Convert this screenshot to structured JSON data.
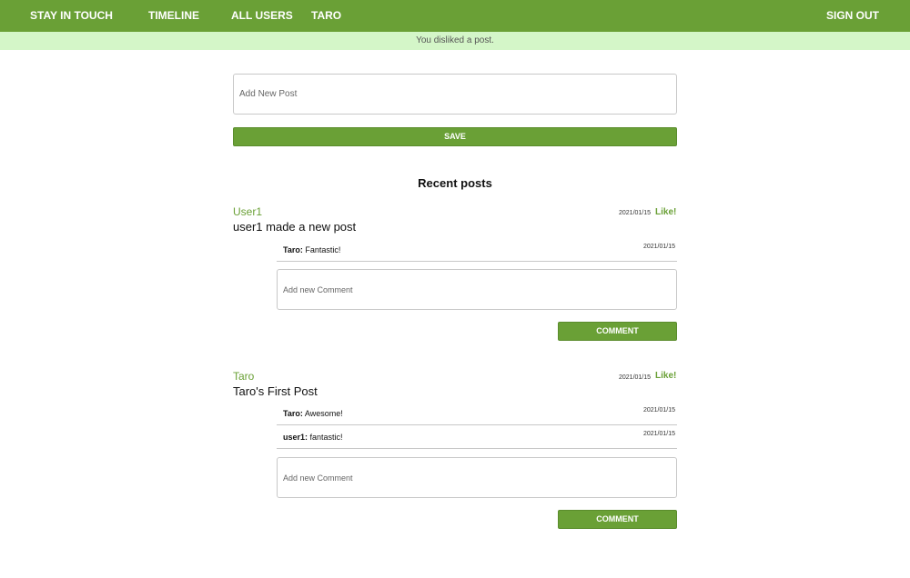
{
  "nav": {
    "brand": "STAY IN TOUCH",
    "timeline": "TIMELINE",
    "all_users": "ALL USERS",
    "current_user": "TARO",
    "sign_out": "SIGN OUT"
  },
  "flash": {
    "message": "You disliked a post."
  },
  "new_post": {
    "placeholder": "Add New Post",
    "save_label": "SAVE"
  },
  "recent": {
    "heading": "Recent posts"
  },
  "posts": [
    {
      "author": "User1",
      "date": "2021/01/15",
      "like_label": "Like!",
      "body": "user1 made a new post",
      "comments": [
        {
          "author": "Taro:",
          "text": " Fantastic!",
          "date": "2021/01/15"
        }
      ],
      "comment_placeholder": "Add new Comment",
      "comment_button": "COMMENT"
    },
    {
      "author": "Taro",
      "date": "2021/01/15",
      "like_label": "Like!",
      "body": "Taro's First Post",
      "comments": [
        {
          "author": "Taro:",
          "text": " Awesome!",
          "date": "2021/01/15"
        },
        {
          "author": "user1:",
          "text": " fantastic!",
          "date": "2021/01/15"
        }
      ],
      "comment_placeholder": "Add new Comment",
      "comment_button": "COMMENT"
    }
  ],
  "colors": {
    "navbar": "#6aa036",
    "flash_bg": "#d4f6c8",
    "accent": "#6aa036"
  }
}
